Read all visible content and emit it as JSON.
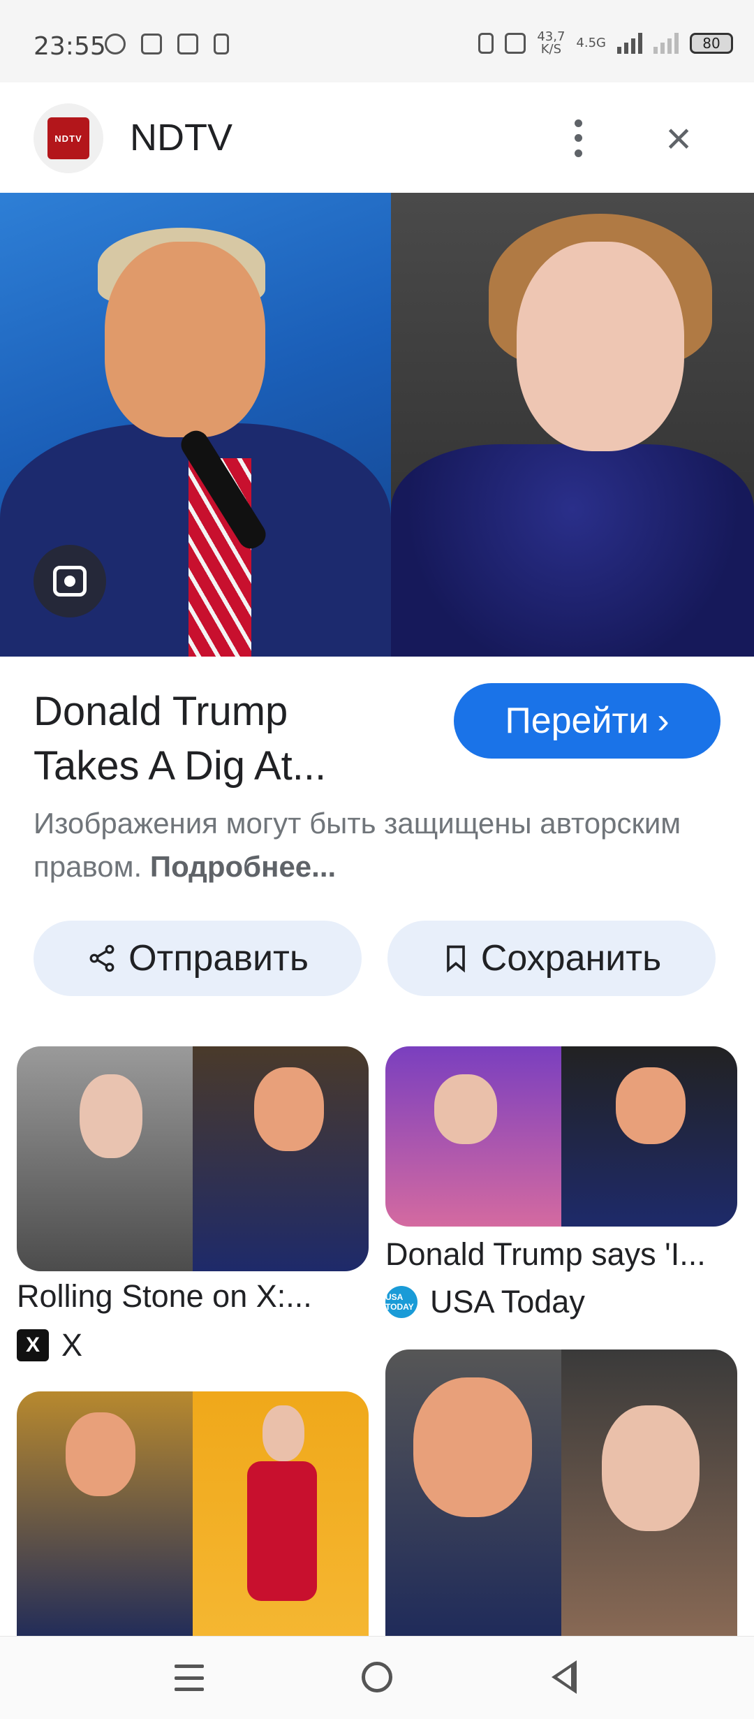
{
  "status_bar": {
    "time": "23:55",
    "net_speed_value": "43,7",
    "net_speed_unit": "K/S",
    "network_type": "4.5G",
    "battery": "80"
  },
  "header": {
    "site_logo_text": "NDTV",
    "site_name": "NDTV"
  },
  "result": {
    "title_line1": "Donald Trump",
    "title_line2": "Takes A Dig At...",
    "go_button_label": "Перейти",
    "go_button_chevron": "›",
    "copyright_text": "Изображения могут быть защищены авторским правом.",
    "more_link": "Подробнее..."
  },
  "actions": {
    "share_label": "Отправить",
    "save_label": "Сохранить"
  },
  "related": [
    {
      "caption": "Rolling Stone on X:...",
      "source": "X",
      "source_badge": "X"
    },
    {
      "caption": "Donald Trump says 'I...",
      "source": "USA Today",
      "source_badge": "USA TODAY"
    }
  ]
}
